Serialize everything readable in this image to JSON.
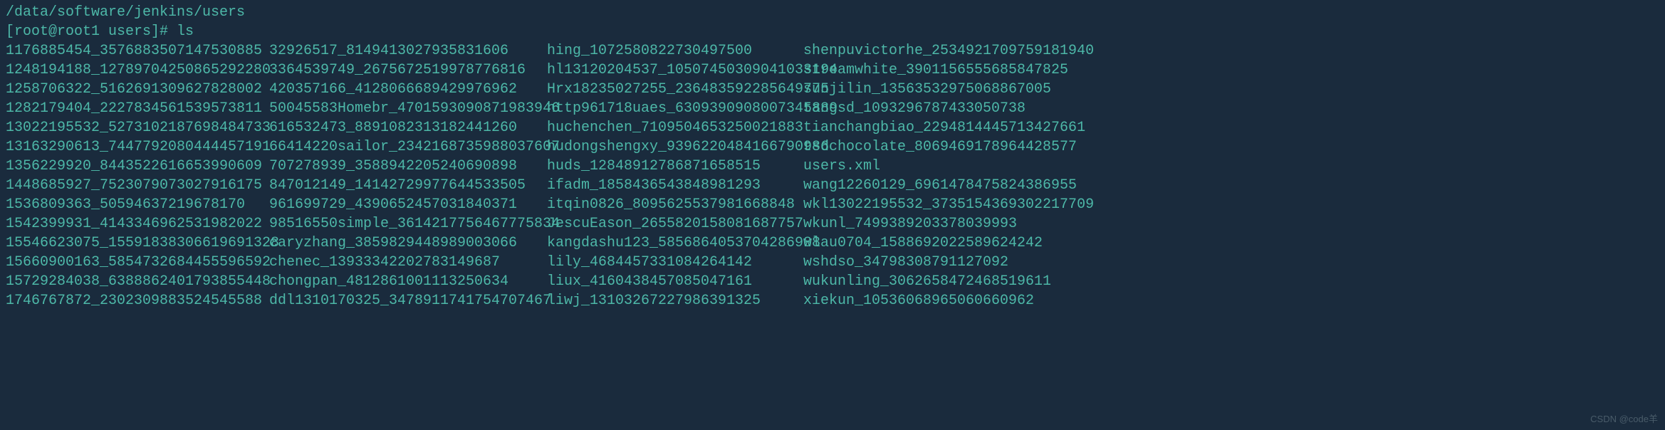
{
  "path_line": "/data/software/jenkins/users",
  "prompt": {
    "prefix": "[root@root1 users]# ",
    "command": "ls"
  },
  "columns": [
    [
      "1176885454_3576883507147530885",
      "1248194188_12789704250865292280",
      "1258706322_5162691309627828002",
      "1282179404_2227834561539573811",
      "13022195532_5273102187698484733",
      "13163290613_7447792080444457191",
      "1356229920_8443522616653990609",
      "1448685927_7523079073027916175",
      "1536809363_50594637219678170",
      "1542399931_4143346962531982022",
      "15546623075_15591838306619691328",
      "15660900163_5854732684455596592",
      "15729284038_6388862401793855448",
      "1746767872_2302309883524545588"
    ],
    [
      "32926517_8149413027935831606",
      "3364539749_2675672519978776816",
      "420357166_4128066689429976962",
      "50045583Homebr_4701593090871983946",
      "616532473_8891082313182441260",
      "66414220sailor_2342168735988037607",
      "707278939_3588942205240690898",
      "847012149_14142729977644533505",
      "961699729_4390652457031840371",
      "98516550simple_3614217756467775834",
      "caryzhang_3859829448989003066",
      "chenec_13933342202783149687",
      "chongpan_4812861001113250634",
      "ddl1310170325_3478911741754707467"
    ],
    [
      "hing_1072580822730497500",
      "hl13120204537_10507450309041033194",
      "Hrx18235027255_236483592285649775",
      "http961718uaes_6309390908007345889",
      "huchenchen_7109504653250021883",
      "hudongshengxy_9396220484166790986",
      "huds_12848912786871658515",
      "ifadm_1858436543848981293",
      "itqin0826_8095625537981668848",
      "JescuEason_2655820158081687757",
      "kangdashu123_5856864053704286988",
      "lily_4684457331084264142",
      "liux_4160438457085047161",
      "liwj_13103267227986391325"
    ],
    [
      "shenpuvictorhe_2534921709759181940",
      "streamwhite_3901156555685847825",
      "sunjilin_13563532975068867005",
      "tangsd_1093296787433050738",
      "tianchangbiao_2294814445713427661",
      "tsdchocolate_8069469178964428577",
      "users.xml",
      "wang12260129_6961478475824386955",
      "wkl13022195532_3735154369302217709",
      "wkunl_7499389203378039993",
      "wlau0704_1588692022589624242",
      "wshdso_34798308791127092",
      "wukunling_3062658472468519611",
      "xiekun_10536068965060660962"
    ]
  ],
  "watermark": "CSDN @code羊"
}
